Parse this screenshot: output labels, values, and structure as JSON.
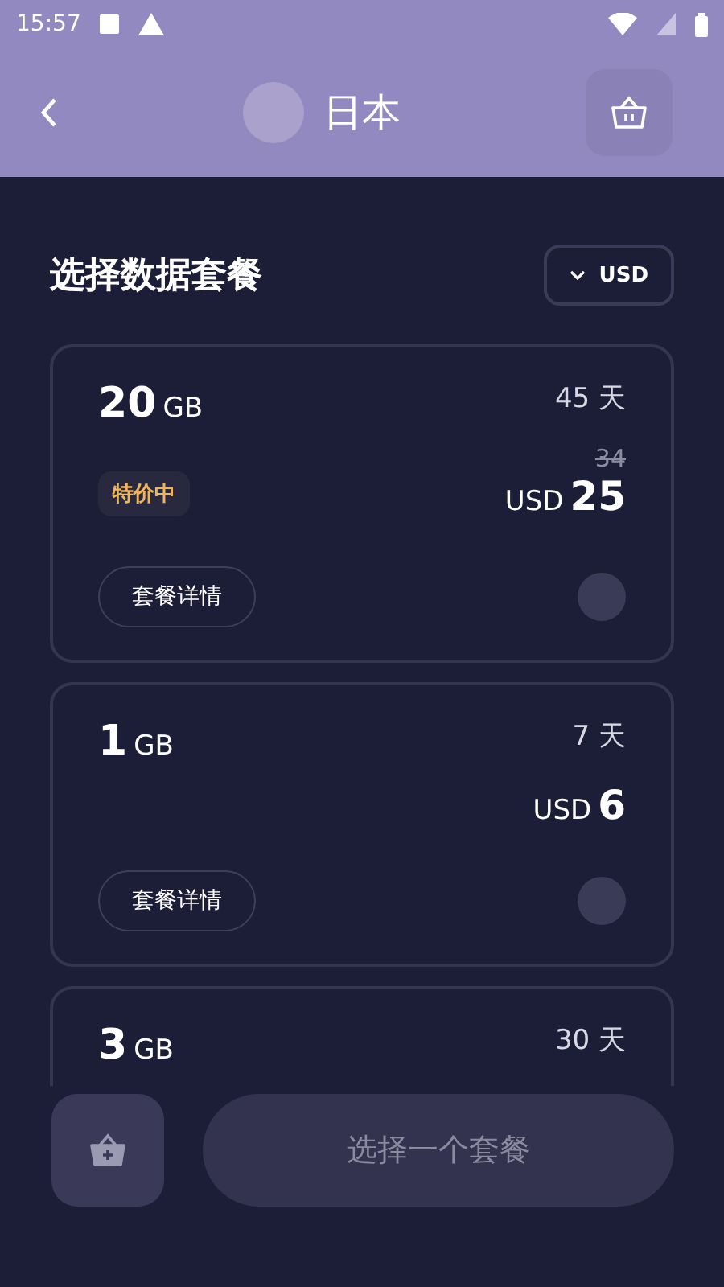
{
  "status_bar": {
    "time": "15:57"
  },
  "header": {
    "title": "日本"
  },
  "section": {
    "title": "选择数据套餐",
    "currency_button": "USD"
  },
  "plans": [
    {
      "amount": "20",
      "unit": "GB",
      "days": "45 天",
      "old_price": "34",
      "currency": "USD",
      "price": "25",
      "badge": "特价中",
      "details_button": "套餐详情",
      "selected": false
    },
    {
      "amount": "1",
      "unit": "GB",
      "days": "7 天",
      "currency": "USD",
      "price": "6",
      "details_button": "套餐详情",
      "selected": false
    },
    {
      "amount": "3",
      "unit": "GB",
      "days": "30 天"
    }
  ],
  "bottom_bar": {
    "primary_button": "选择一个套餐",
    "primary_disabled": true
  }
}
